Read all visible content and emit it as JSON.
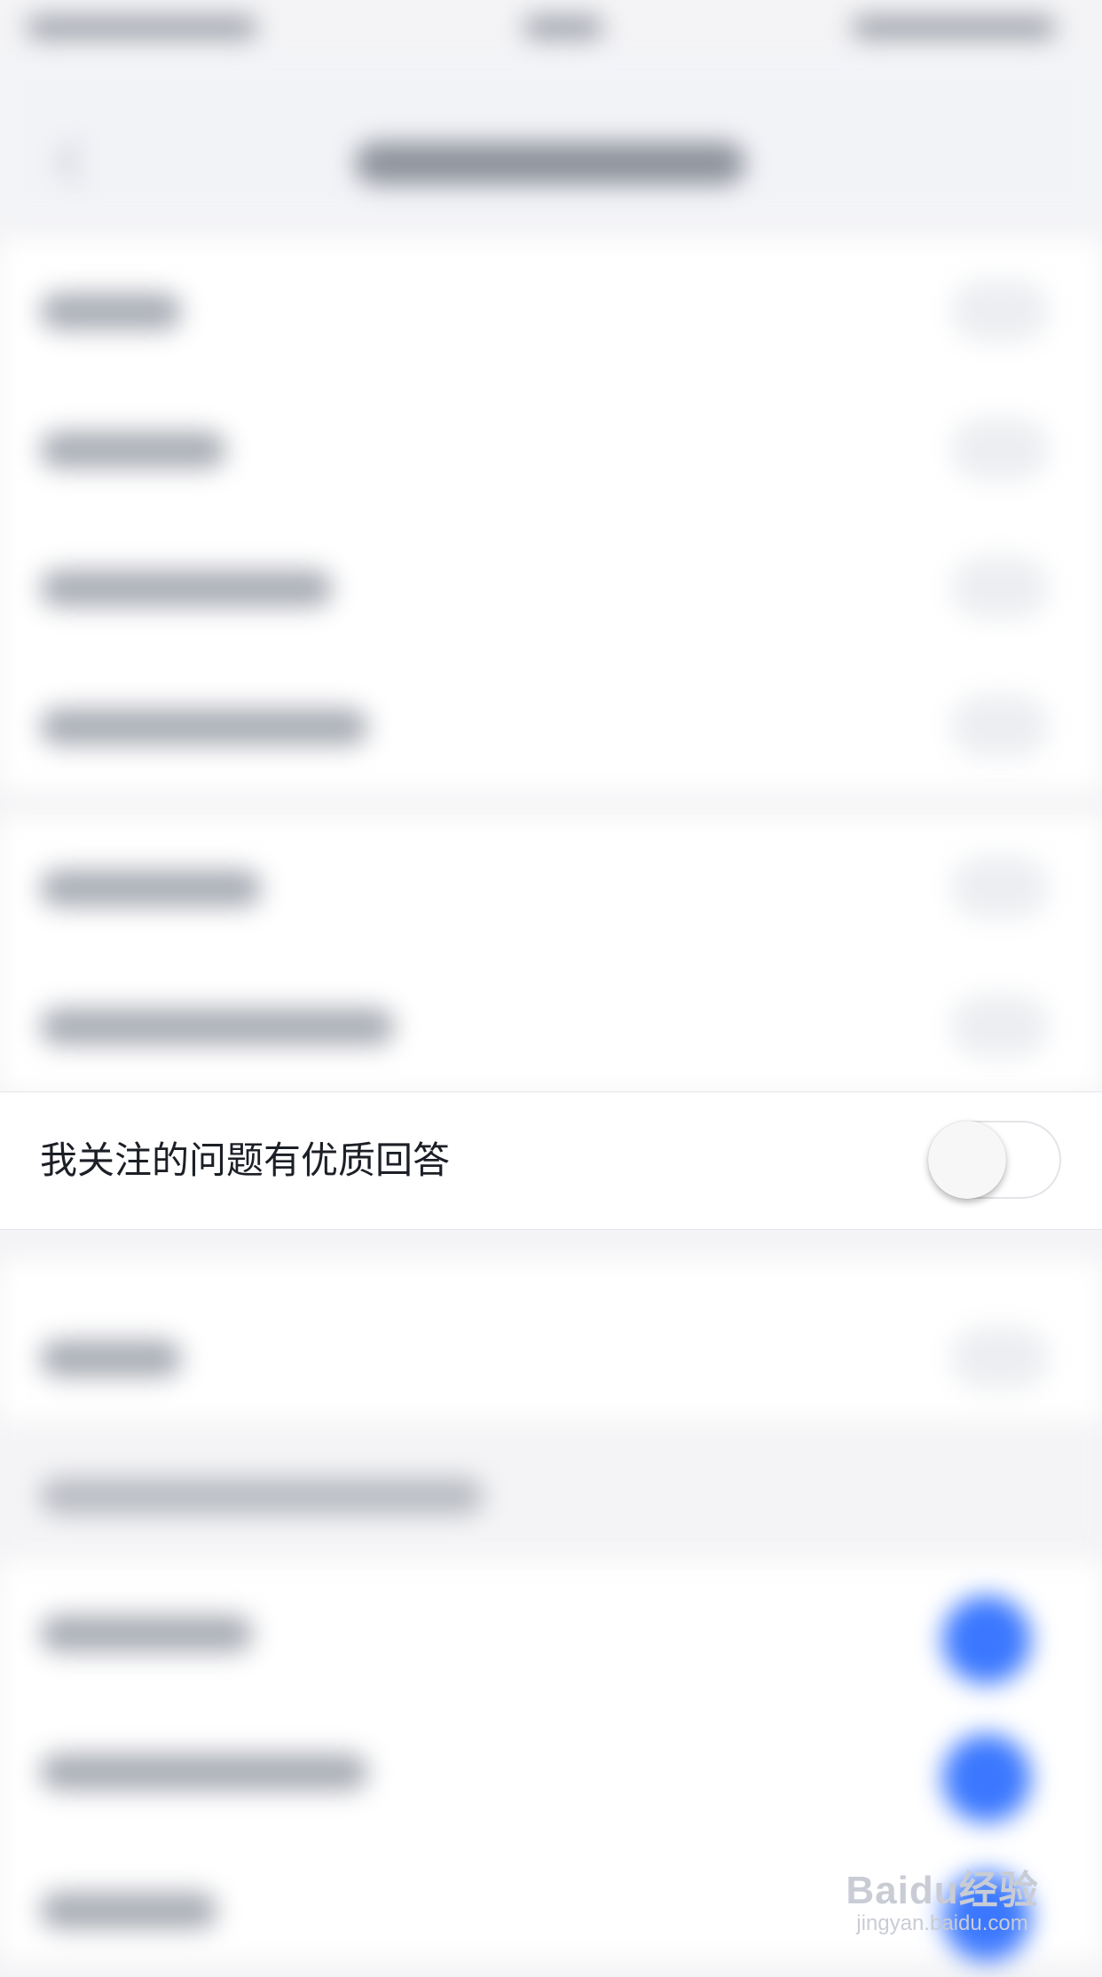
{
  "notification_settings": {
    "focused_item": {
      "label": "我关注的问题有优质回答",
      "toggle_on": false
    }
  },
  "watermark": {
    "logo_text": "Baidu经验",
    "url": "jingyan.baidu.com"
  },
  "colors": {
    "toggle_active": "#3b78ff",
    "background": "#f4f4f6"
  }
}
